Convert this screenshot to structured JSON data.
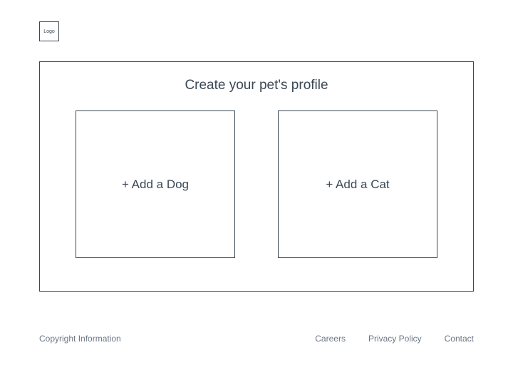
{
  "header": {
    "logo_text": "Logo"
  },
  "main": {
    "title": "Create your pet's profile",
    "options": [
      {
        "label": "+ Add a Dog"
      },
      {
        "label": "+ Add a Cat"
      }
    ]
  },
  "footer": {
    "copyright": "Copyright Information",
    "links": [
      {
        "label": "Careers"
      },
      {
        "label": "Privacy Policy"
      },
      {
        "label": "Contact"
      }
    ]
  }
}
